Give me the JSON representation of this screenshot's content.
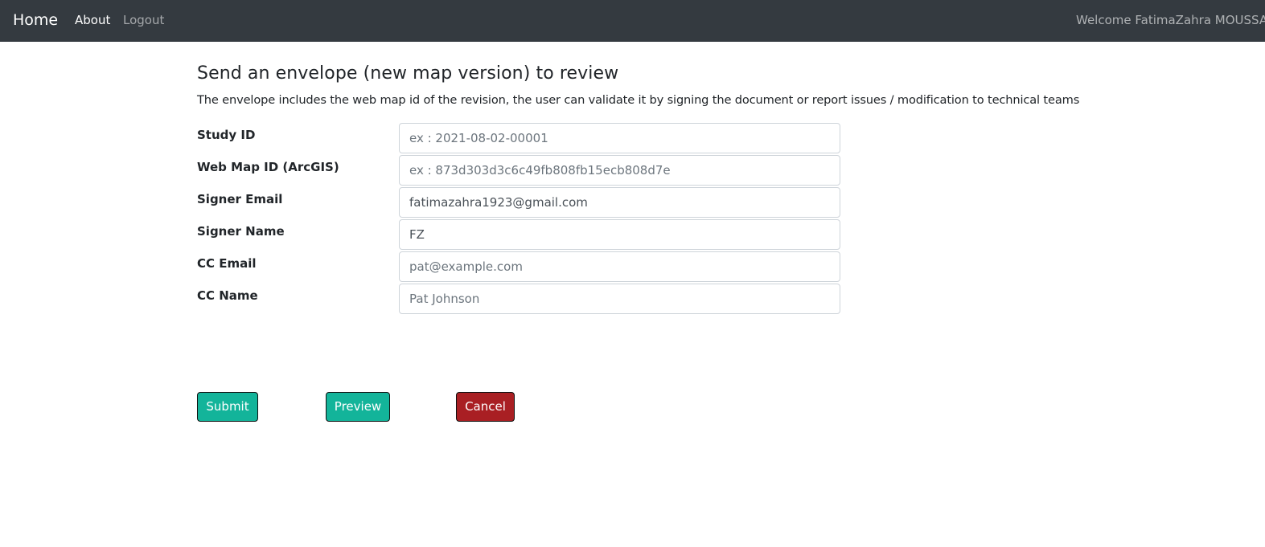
{
  "navbar": {
    "brand": "Home",
    "links": [
      {
        "label": "About"
      },
      {
        "label": "Logout"
      }
    ],
    "welcome": "Welcome FatimaZahra MOUSSAI",
    "bg_color": "#343a40"
  },
  "main": {
    "title": "Send an envelope (new map version) to review",
    "description": "The envelope includes the web map id of the revision, the user can validate it by signing the document or report issues / modification to technical teams"
  },
  "form": {
    "fields": [
      {
        "label": "Study ID",
        "value": "",
        "placeholder": "ex : 2021-08-02-00001"
      },
      {
        "label": "Web Map ID (ArcGIS)",
        "value": "",
        "placeholder": "ex : 873d303d3c6c49fb808fb15ecb808d7e"
      },
      {
        "label": "Signer Email",
        "value": "fatimazahra1923@gmail.com",
        "placeholder": ""
      },
      {
        "label": "Signer Name",
        "value": "FZ",
        "placeholder": ""
      },
      {
        "label": "CC Email",
        "value": "",
        "placeholder": "pat@example.com"
      },
      {
        "label": "CC Name",
        "value": "",
        "placeholder": "Pat Johnson"
      }
    ]
  },
  "actions": {
    "submit_label": "Submit",
    "preview_label": "Preview",
    "cancel_label": "Cancel",
    "primary_color": "#13b49a",
    "danger_color": "#a91f23"
  }
}
